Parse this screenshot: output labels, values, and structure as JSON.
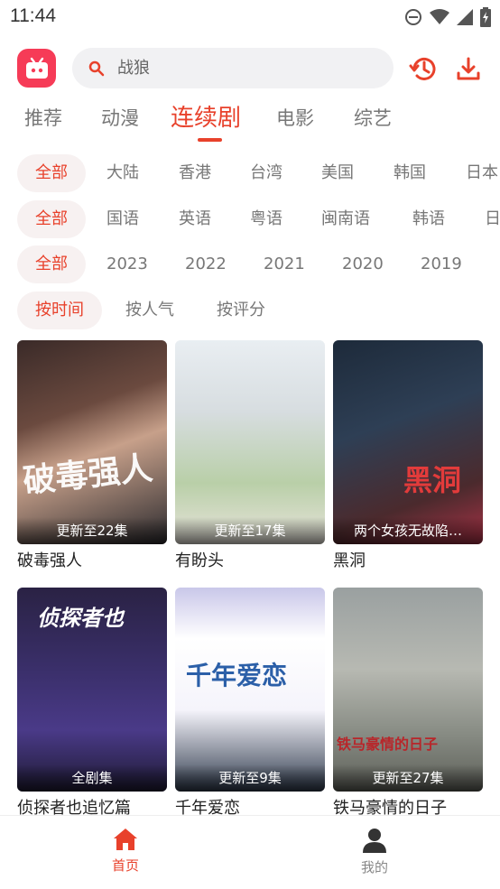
{
  "status": {
    "time": "11:44"
  },
  "search": {
    "placeholder": "战狼"
  },
  "tabs": [
    {
      "label": "推荐",
      "active": false
    },
    {
      "label": "动漫",
      "active": false
    },
    {
      "label": "连续剧",
      "active": true
    },
    {
      "label": "电影",
      "active": false
    },
    {
      "label": "综艺",
      "active": false
    }
  ],
  "filters": {
    "region": [
      "全部",
      "大陆",
      "香港",
      "台湾",
      "美国",
      "韩国",
      "日本"
    ],
    "language": [
      "全部",
      "国语",
      "英语",
      "粤语",
      "闽南语",
      "韩语",
      "日"
    ],
    "year": [
      "全部",
      "2023",
      "2022",
      "2021",
      "2020",
      "2019"
    ],
    "sort": [
      "按时间",
      "按人气",
      "按评分"
    ]
  },
  "cards": [
    {
      "title": "破毒强人",
      "caption": "更新至22集",
      "poster_text": "破毒强人"
    },
    {
      "title": "有盼头",
      "caption": "更新至17集",
      "poster_text": ""
    },
    {
      "title": "黑洞",
      "caption": "两个女孩无故陷…",
      "poster_text": "黑洞"
    },
    {
      "title": "侦探者也追忆篇",
      "caption": "全剧集",
      "poster_text": "侦探者也"
    },
    {
      "title": "千年爱恋",
      "caption": "更新至9集",
      "poster_text": "千年爱恋"
    },
    {
      "title": "铁马豪情的日子",
      "caption": "更新至27集",
      "poster_text": "铁马豪情的日子"
    }
  ],
  "nav": {
    "home_label": "首页",
    "mine_label": "我的"
  },
  "colors": {
    "accent": "#e8412b",
    "logo": "#f63b57"
  },
  "icons": {
    "logo": "tv-logo-icon",
    "search": "search-icon",
    "history": "history-icon",
    "download": "download-icon",
    "home": "home-icon",
    "user": "user-icon"
  }
}
